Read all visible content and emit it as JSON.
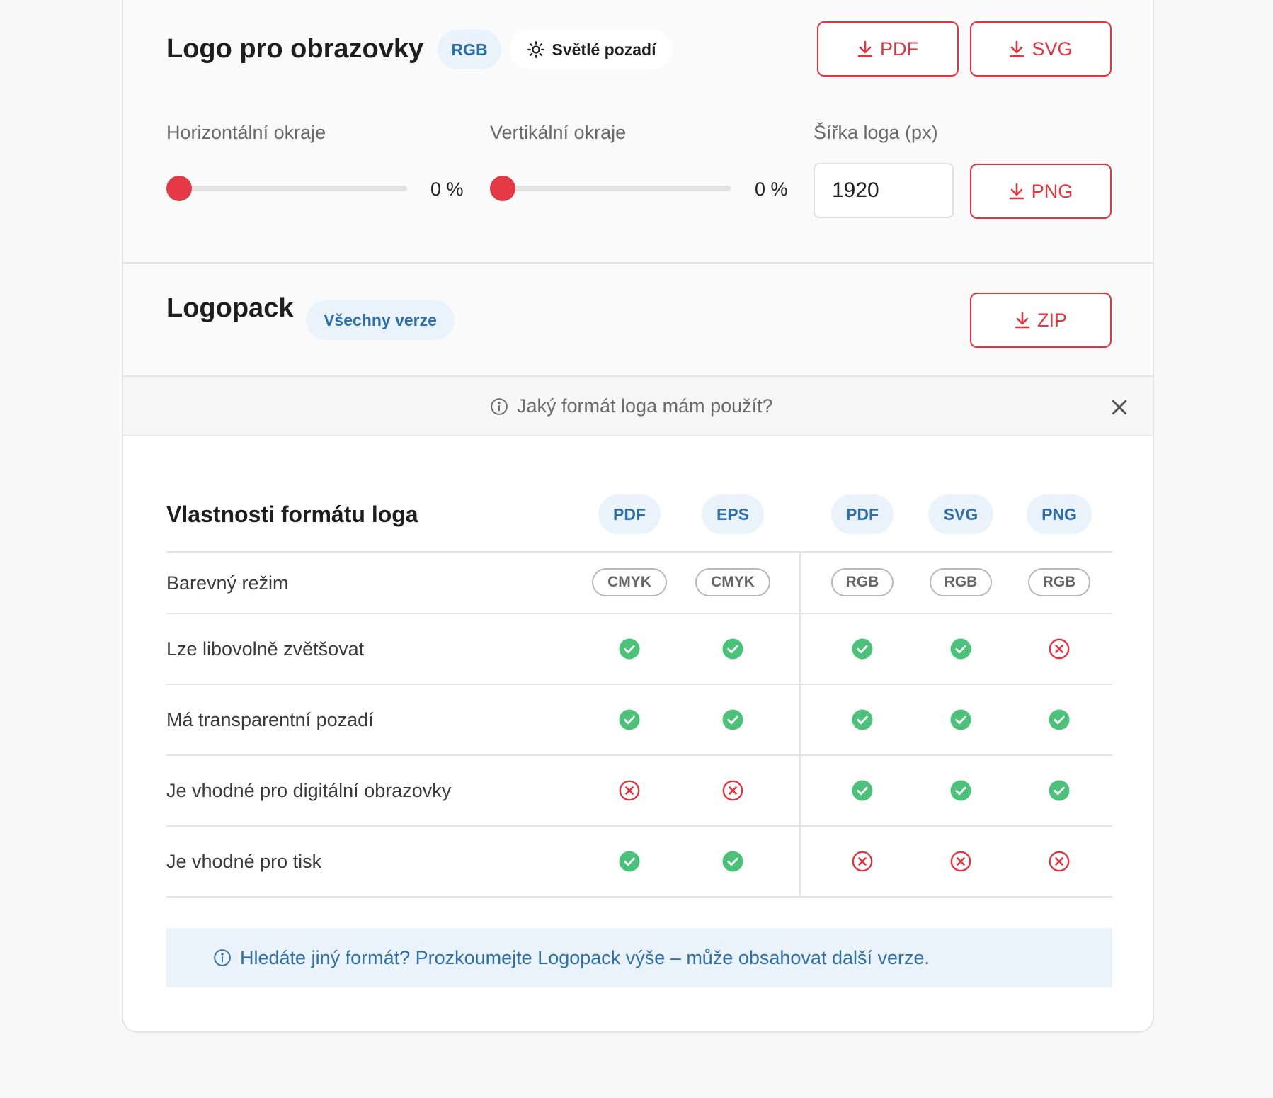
{
  "screen_logo": {
    "title": "Logo pro obrazovky",
    "badge": "RGB",
    "background_toggle": "Světlé pozadí",
    "buttons": {
      "pdf": "PDF",
      "svg": "SVG",
      "png": "PNG"
    },
    "horizontal_margin": {
      "label": "Horizontální okraje",
      "value_text": "0 %",
      "value": 0
    },
    "vertical_margin": {
      "label": "Vertikální okraje",
      "value_text": "0 %",
      "value": 0
    },
    "width": {
      "label": "Šířka loga (px)",
      "value": "1920"
    }
  },
  "logopack": {
    "title": "Logopack",
    "badge": "Všechny verze",
    "button": "ZIP"
  },
  "faq": {
    "question": "Jaký formát loga mám použít?"
  },
  "format_table": {
    "title": "Vlastnosti formátu loga",
    "columns": [
      "PDF",
      "EPS",
      "PDF",
      "SVG",
      "PNG"
    ],
    "color_mode_label": "Barevný režim",
    "color_modes": [
      "CMYK",
      "CMYK",
      "RGB",
      "RGB",
      "RGB"
    ],
    "rows": [
      {
        "label": "Lze libovolně zvětšovat",
        "values": [
          true,
          true,
          true,
          true,
          false
        ]
      },
      {
        "label": "Má transparentní pozadí",
        "values": [
          true,
          true,
          true,
          true,
          true
        ]
      },
      {
        "label": "Je vhodné pro digitální obrazovky",
        "values": [
          false,
          false,
          true,
          true,
          true
        ]
      },
      {
        "label": "Je vhodné pro tisk",
        "values": [
          true,
          true,
          false,
          false,
          false
        ]
      }
    ],
    "note": "Hledáte jiný formát? Prozkoumejte Logopack výše – může obsahovat další verze."
  },
  "colors": {
    "accent_red": "#e5333f",
    "check_green": "#4cc17a",
    "info_blue": "#2e6fa7",
    "info_bg": "#eaf3fc"
  }
}
